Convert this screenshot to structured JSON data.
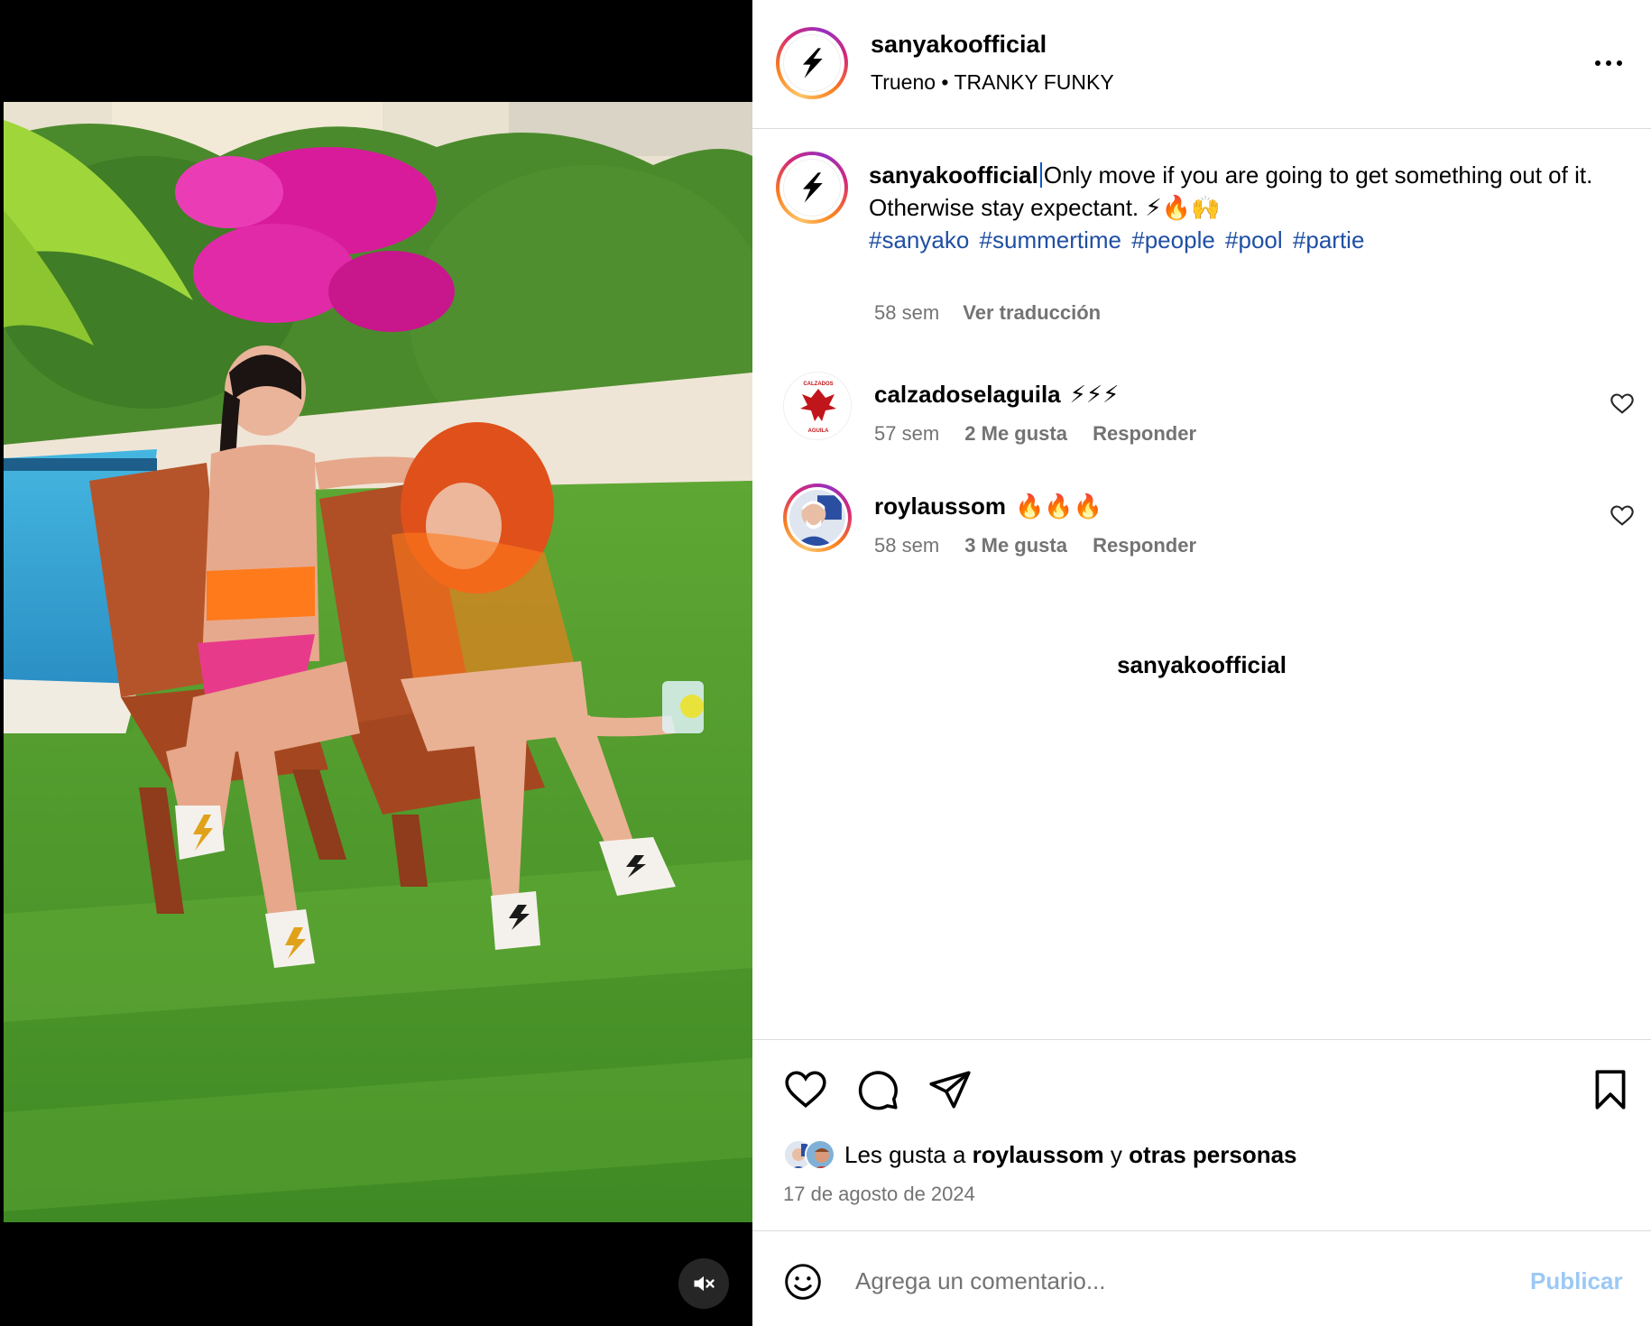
{
  "post": {
    "username": "sanyakoofficial",
    "subtitle": "Trueno • TRANKY FUNKY"
  },
  "caption": {
    "username": "sanyakoofficial",
    "line1": "Only move if you are going to get something out of it.",
    "line2": "Otherwise stay expectant. ⚡🔥🙌",
    "hashtags": [
      "#sanyako",
      "#summertime",
      "#people",
      "#pool",
      "#partie"
    ],
    "time": "58 sem",
    "translate": "Ver traducción"
  },
  "comments": [
    {
      "username": "calzadoselaguila",
      "text": "⚡⚡⚡",
      "time": "57 sem",
      "likes": "2 Me gusta",
      "reply": "Responder",
      "avatar_text": "CALZADOS AGUILA"
    },
    {
      "username": "roylaussom",
      "text": "🔥🔥🔥",
      "time": "58 sem",
      "likes": "3 Me gusta",
      "reply": "Responder"
    }
  ],
  "more_from": "sanyakoofficial",
  "likes": {
    "prefix": "Les gusta a",
    "user": "roylaussom",
    "joiner": "y",
    "others": "otras personas"
  },
  "date": "17 de agosto de 2024",
  "comment_box": {
    "placeholder": "Agrega un comentario...",
    "publish": "Publicar"
  },
  "colors": {
    "link": "#1f4fa3",
    "muted": "#737373",
    "publish_disabled": "#9cc8f5",
    "border": "#dbdbdb"
  },
  "icons": [
    "lightning-logo-icon",
    "more-icon",
    "heart-icon",
    "comment-icon",
    "share-icon",
    "bookmark-icon",
    "emoji-icon",
    "mute-icon"
  ]
}
